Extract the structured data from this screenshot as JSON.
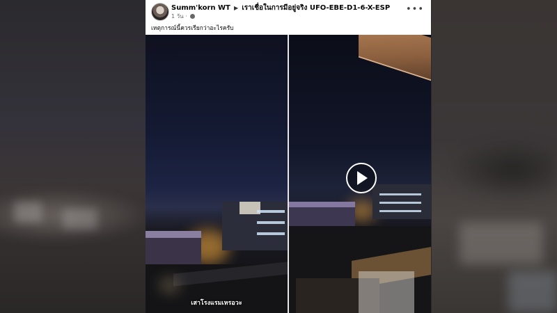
{
  "post": {
    "author": "Summ'korn WT",
    "group": "เราเชื่อในการมีอยู่จริง UFO-EBE-D1-6-X-ESP",
    "time": "1 วัน",
    "caption": "เหตุการณ์นี้ควรเรียกว่าอะไรครับ",
    "more_label": "•••"
  },
  "media": {
    "subtitle": "เสาโรงแรมเหรอวะ",
    "play_icon": "play-icon"
  },
  "colors": {
    "sky_left": "#141a33",
    "sky_right": "#121629",
    "window_light": "#cfe3f6",
    "street_glow": "#e8a23a"
  }
}
